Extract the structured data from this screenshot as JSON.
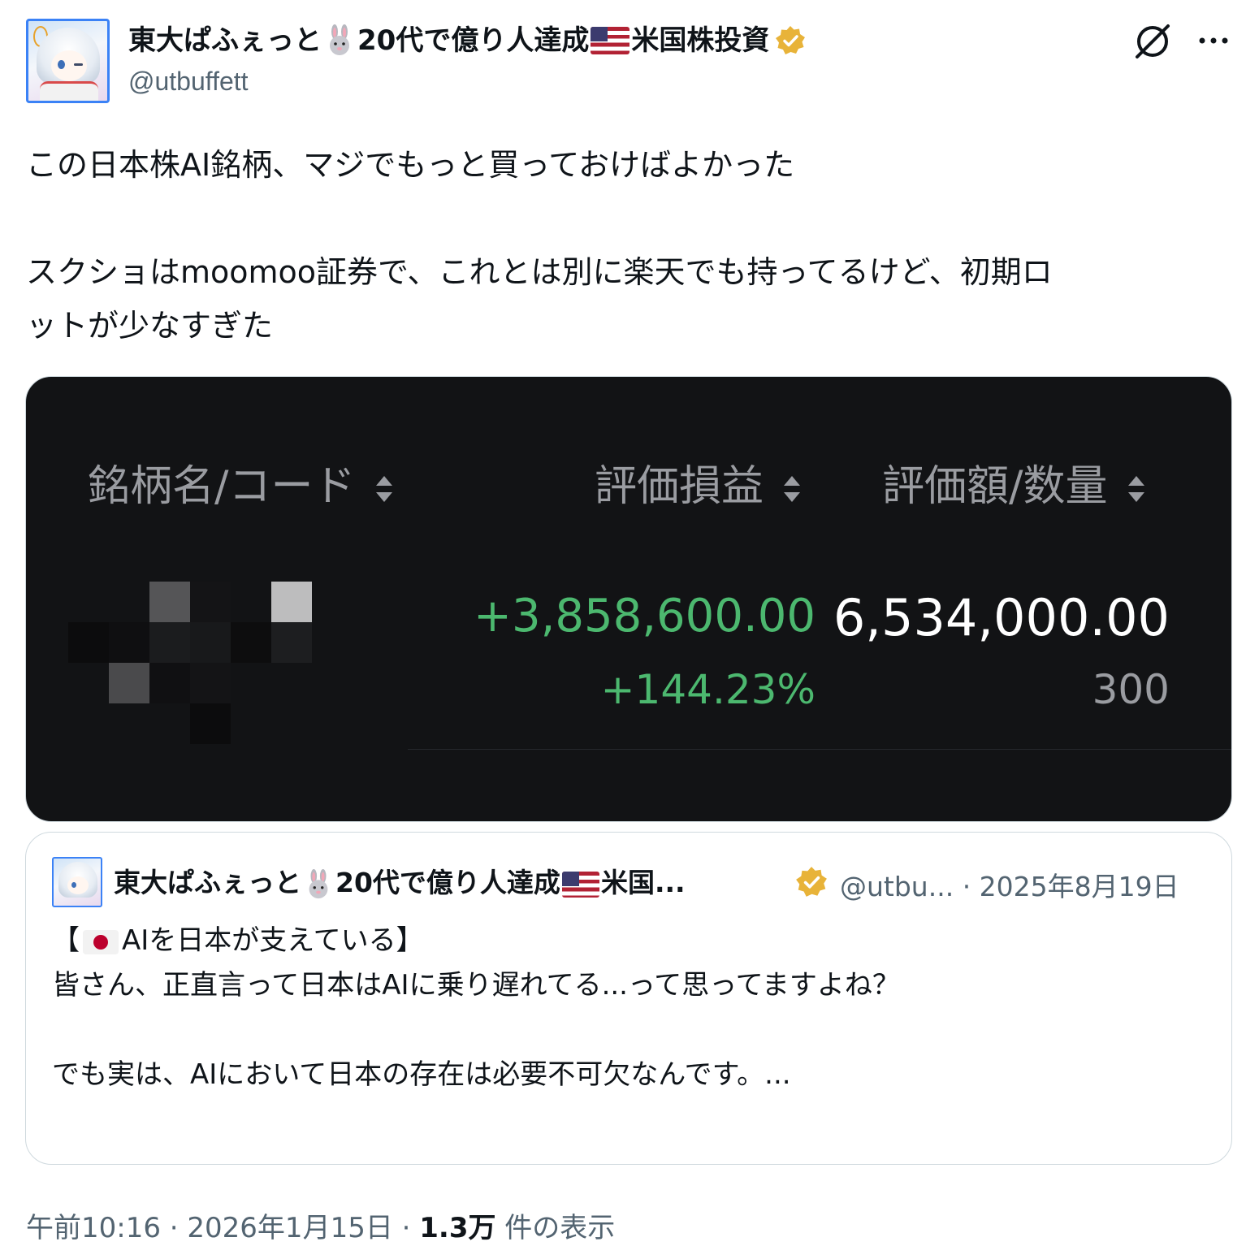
{
  "author": {
    "name_part1": "東大ぱふぇっと",
    "name_part2": "20代で億り人達成",
    "name_part3": "米国株投資",
    "handle": "@utbuffett",
    "icons": [
      "rabbit-emoji",
      "us-flag-emoji",
      "verified-badge-icon"
    ]
  },
  "tweet": {
    "text": "この日本株AI銘柄、マジでもっと買っておけばよかった\n\nスクショはmoomoo証券で、これとは別に楽天でも持ってるけど、初期ロ\nットが少なすぎた"
  },
  "screenshot": {
    "col_name": "銘柄名/コード",
    "col_pl": "評価損益",
    "col_value": "評価額/数量",
    "pl_amount": "+3,858,600.00",
    "pl_percent": "+144.23%",
    "market_value": "6,534,000.00",
    "quantity": "300",
    "colors": {
      "gain": "#4cb86f",
      "background": "#121315"
    }
  },
  "quoted": {
    "name_part1": "東大ぱふぇっと",
    "name_part2": "20代で億り人達成",
    "name_part3": "米国...",
    "handle": "@utbu...",
    "date": "· 2025年8月19日",
    "title_open": "【",
    "title_text": "AIを日本が支えている】",
    "body": "皆さん、正直言って日本はAIに乗り遅れてる...って思ってますよね？\n\nでも実は、AIにおいて日本の存在は必要不可欠なんです。..."
  },
  "footer": {
    "time": "午前10:16 · 2026年1月15日 · ",
    "views": "1.3万",
    "views_label": " 件の表示"
  }
}
